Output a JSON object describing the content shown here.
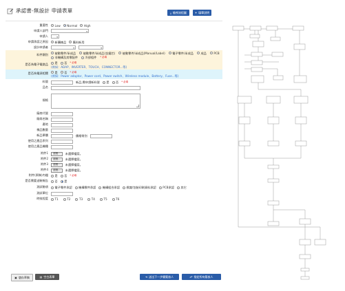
{
  "header": {
    "title": "承認書-無設計 申請表單",
    "btn_flowchart": "檢視流程圖",
    "btn_help": "填單說明"
  },
  "form": {
    "importance": {
      "label": "重要性",
      "options": [
        "Low",
        "Normal",
        "High"
      ],
      "selected": "Normal"
    },
    "dept": {
      "label": "申請人部門",
      "value": ""
    },
    "applicant": {
      "label": "申請人",
      "value": ""
    },
    "method": {
      "label": "申請承認之原因",
      "options": [
        "新購樣品",
        "舊料新用"
      ]
    },
    "designer": {
      "label": "設計申請者",
      "value1": "",
      "value2": ""
    },
    "category": {
      "label": "料件類別",
      "options": [
        "被動零件/半成品",
        "被動零件/半成品(含鐵芯)",
        "被動零件/半成品(Manual/Label)",
        "電子零件/半成品",
        "成品",
        "PCB",
        "非機構及其零配件",
        "冷卻組件"
      ],
      "required": "* 必填"
    },
    "ee_part": {
      "label": "是否為電子電路品",
      "options": [
        "是",
        "否"
      ],
      "required": "* 必填",
      "note": "(例如：ADAP、INVERTER、TOUCH、CONNECTOR...等)"
    },
    "power_part": {
      "label": "是否為電源相關",
      "options": [
        "是",
        "否"
      ],
      "required": "* 必填",
      "note": "(例如：Power adaptor、Power cord、Power switch、Wireless module、Battery、Fuse...等)"
    },
    "part_no": {
      "label": "料號",
      "value": "",
      "new_label": "新品,需申請新料號",
      "options": [
        "是",
        "否"
      ],
      "required": "* 必填"
    },
    "part_name": {
      "label": "品名",
      "value": ""
    },
    "spec": {
      "label": "規格",
      "value": ""
    },
    "vendor_code": {
      "label": "廠商代號",
      "value": ""
    },
    "vendor_name": {
      "label": "廠商名稱",
      "value": ""
    },
    "origin": {
      "label": "產地",
      "value": ""
    },
    "sample_qty": {
      "label": "樣品數量",
      "value": ""
    },
    "unit_price": {
      "label": "新品單價",
      "value": "",
      "currency_label": "價格幣別",
      "currency_value": ""
    },
    "applied_series": {
      "label": "使用之產品系列",
      "value": ""
    },
    "applied_model": {
      "label": "使用之產品機種",
      "value": ""
    },
    "attachments": [
      {
        "label": "附件1",
        "button": "瀏覽...",
        "status": "未選擇檔案。"
      },
      {
        "label": "附件2",
        "button": "瀏覽...",
        "status": "未選擇檔案。"
      },
      {
        "label": "附件3",
        "button": "瀏覽...",
        "status": "未選擇檔案。"
      },
      {
        "label": "附件4",
        "button": "瀏覽...",
        "status": "未選擇檔案。"
      }
    ],
    "attach_inside": {
      "label": "附件(原稿)內檔",
      "options": [
        "是",
        "否"
      ],
      "required": "* 必填"
    },
    "send_test": {
      "label": "是否需要送驗報告",
      "options": [
        "否",
        "是"
      ],
      "selected": "是"
    },
    "test_item": {
      "label": "測試驗項",
      "options": [
        "電子零件承認",
        "機構零件承認",
        "機構組合承認",
        "標識/包裝印刷資料承認",
        "PCB承認",
        "其它"
      ]
    },
    "test_unit": {
      "label": "測試單位",
      "value": ""
    },
    "priority": {
      "label": "時效程度",
      "options": [
        "T1",
        "T2",
        "T3",
        "T4",
        "T5",
        "T6"
      ]
    }
  },
  "footer": {
    "btn_save": "儲存草稿",
    "btn_blank": "空白表單",
    "btn_next": "送出下一步驟簽核人",
    "btn_send": "指定所有簽核人"
  },
  "colors": {
    "primary": "#2a5ca8",
    "required": "#e02020",
    "note": "#2f6fd0",
    "yellow_bg": "#fdf4dc",
    "cyan_bg": "#def4fb"
  }
}
